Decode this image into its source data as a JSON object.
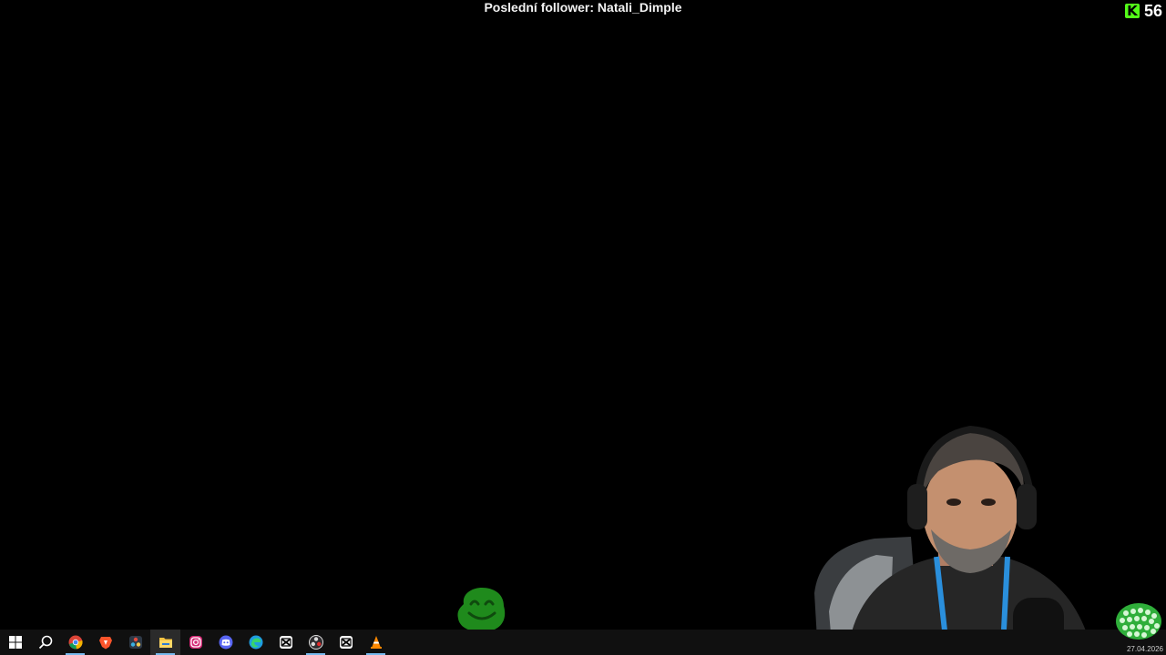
{
  "overlay": {
    "last_follower": "Poslední follower: Natali_Dimple"
  },
  "kick": {
    "logo_letter": "K",
    "count": "56",
    "accent": "#53fc18"
  },
  "taskbar": {
    "apps": [
      {
        "name": "windows-start",
        "icon": "windows-logo-icon"
      },
      {
        "name": "search",
        "icon": "search-icon"
      },
      {
        "name": "chrome",
        "icon": "chrome-icon"
      },
      {
        "name": "brave",
        "icon": "brave-icon"
      },
      {
        "name": "davinci",
        "icon": "davinci-resolve-icon"
      },
      {
        "name": "file-explorer",
        "icon": "folder-icon"
      },
      {
        "name": "instagram",
        "icon": "instagram-icon"
      },
      {
        "name": "discord",
        "icon": "discord-icon"
      },
      {
        "name": "edge",
        "icon": "edge-icon"
      },
      {
        "name": "capcut",
        "icon": "capcut-icon"
      },
      {
        "name": "obs",
        "icon": "obs-icon"
      },
      {
        "name": "capcut-2",
        "icon": "capcut-icon"
      },
      {
        "name": "vlc",
        "icon": "vlc-icon"
      }
    ],
    "date": "27.04.2026"
  }
}
